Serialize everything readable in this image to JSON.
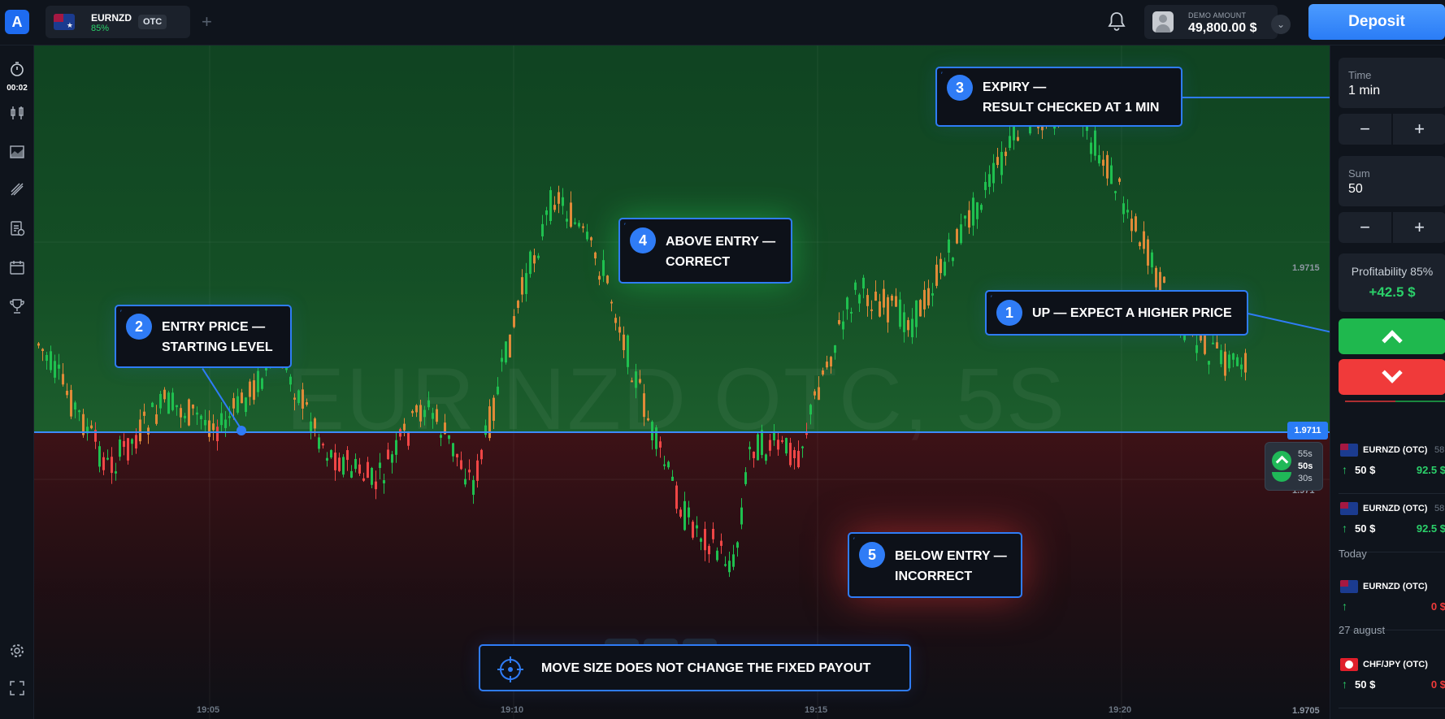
{
  "topbar": {
    "logo": "A",
    "asset": {
      "name": "EURNZD",
      "percent": "85%",
      "badge": "OTC",
      "flag": "nz-flag-icon"
    },
    "add_tab": "+",
    "account": {
      "label": "DEMO AMOUNT",
      "value": "49,800.00 $"
    },
    "deposit_label": "Deposit"
  },
  "sidebar": {
    "timer": "00:02"
  },
  "chart": {
    "watermark": "EUR NZD OTC, 5S",
    "price_labels": [
      "1.9715",
      "1.971",
      "1.9705"
    ],
    "current_price": "1.9711",
    "time_labels": [
      "19:05",
      "19:10",
      "19:15",
      "19:20"
    ],
    "timer": [
      "55s",
      "50s",
      "30s"
    ],
    "colors": {
      "up": "#1fc04f",
      "down": "#f04646",
      "orange": "#e08a38",
      "entry": "#3b8bff"
    }
  },
  "callouts": [
    {
      "num": "1",
      "lines": [
        "UP — EXPECT A HIGHER PRICE"
      ]
    },
    {
      "num": "2",
      "lines": [
        "ENTRY PRICE —",
        "STARTING LEVEL"
      ]
    },
    {
      "num": "3",
      "lines": [
        "EXPIRY —",
        "RESULT CHECKED AT 1 MIN"
      ]
    },
    {
      "num": "4",
      "lines": [
        "ABOVE ENTRY —",
        "CORRECT"
      ]
    },
    {
      "num": "5",
      "lines": [
        "BELOW ENTRY —",
        "INCORRECT"
      ]
    },
    {
      "num": "",
      "lines": [
        "MOVE SIZE DOES NOT CHANGE THE FIXED PAYOUT"
      ]
    }
  ],
  "panel": {
    "time": {
      "label": "Time",
      "value": "1 min"
    },
    "sum": {
      "label": "Sum",
      "value": "50"
    },
    "profitability": {
      "label": "Profitability 85%",
      "value": "+42.5 $"
    },
    "trades": [
      {
        "name": "EURNZD (OTC)",
        "extra": "58",
        "amount": "50 $",
        "result": "92.5 $"
      },
      {
        "name": "EURNZD (OTC)",
        "extra": "58",
        "amount": "50 $",
        "result": "92.5 $"
      }
    ],
    "today_label": "Today",
    "today_trades": [
      {
        "name": "EURNZD (OTC)",
        "amount": "",
        "result": "0 $"
      }
    ],
    "august_label": "27 august",
    "august_trades": [
      {
        "name": "CHF/JPY (OTC)",
        "amount": "50 $",
        "result": "0 $"
      }
    ]
  }
}
